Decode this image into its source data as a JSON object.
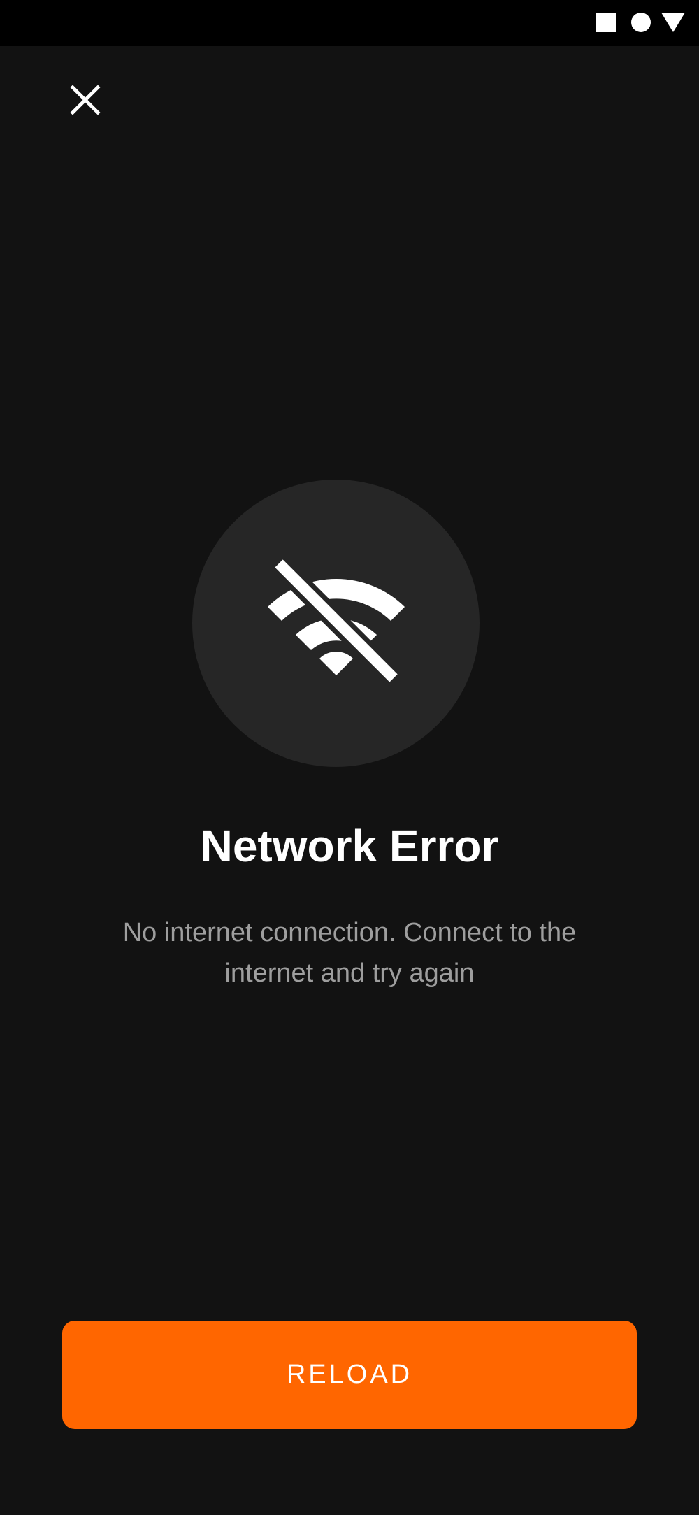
{
  "status_bar": {
    "icons": [
      "square-icon",
      "circle-icon",
      "triangle-icon"
    ]
  },
  "header": {
    "close_icon": "close-icon"
  },
  "error": {
    "icon": "wifi-off-icon",
    "title": "Network Error",
    "message": "No internet connection. Connect to the internet and try again"
  },
  "actions": {
    "reload_label": "RELOAD"
  },
  "colors": {
    "background": "#121212",
    "status_bar": "#000000",
    "icon_circle": "#262626",
    "accent": "#ff6600",
    "title": "#ffffff",
    "message": "#9e9e9e"
  }
}
